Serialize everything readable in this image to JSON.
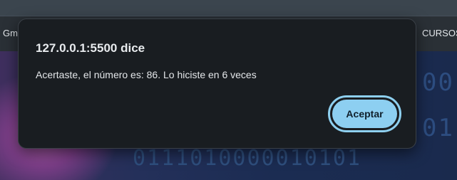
{
  "browser": {
    "bookmark_left": "Gm",
    "bookmark_right": "CURSOS"
  },
  "background": {
    "binary_bottom": "0111010000010101",
    "binary_right_1": "00",
    "binary_right_2": "01"
  },
  "dialog": {
    "title": "127.0.0.1:5500 dice",
    "message": "Acertaste, el número es: 86. Lo hiciste en 6 veces",
    "ok_label": "Aceptar"
  },
  "colors": {
    "dialog_bg": "#191d21",
    "button_bg": "#8dcff1",
    "focus_ring": "#8ed0f0"
  }
}
